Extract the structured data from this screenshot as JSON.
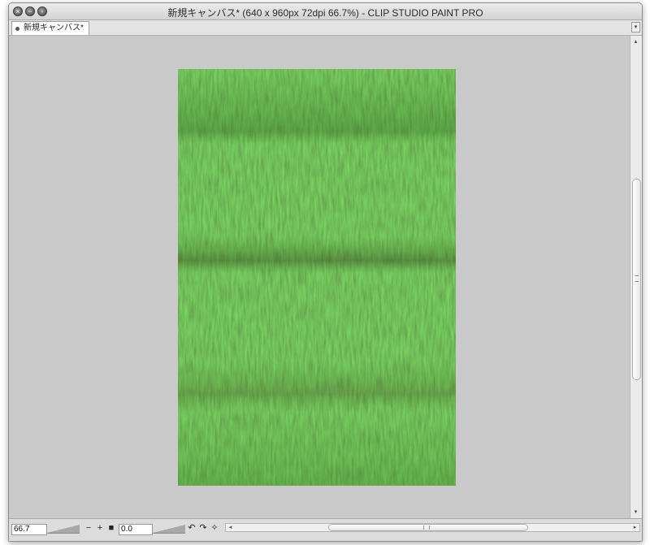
{
  "window": {
    "title": "新規キャンバス* (640 x 960px 72dpi 66.7%)  - CLIP STUDIO PAINT PRO"
  },
  "tabs": [
    {
      "label": "新規キャンバス*",
      "active": true
    }
  ],
  "canvas": {
    "content": "grass texture",
    "background_color": "#c9c9c9",
    "accent_colors": [
      "#3f8a2b",
      "#5fae3c",
      "#2e6b1f",
      "#6b5a2a"
    ]
  },
  "statusbar": {
    "zoom_value": "66.7",
    "zoom_out_icon": "−",
    "zoom_in_icon": "+",
    "fit_icon": "■",
    "angle_value": "0.0",
    "rotate_left_icon": "↶",
    "rotate_right_icon": "↷",
    "reset_icon": "✧",
    "scroll_left_icon": "◂",
    "scroll_right_icon": "▸"
  },
  "vscroll": {
    "up_icon": "▴",
    "down_icon": "▾"
  },
  "tabbar": {
    "menu_icon": "▾"
  }
}
